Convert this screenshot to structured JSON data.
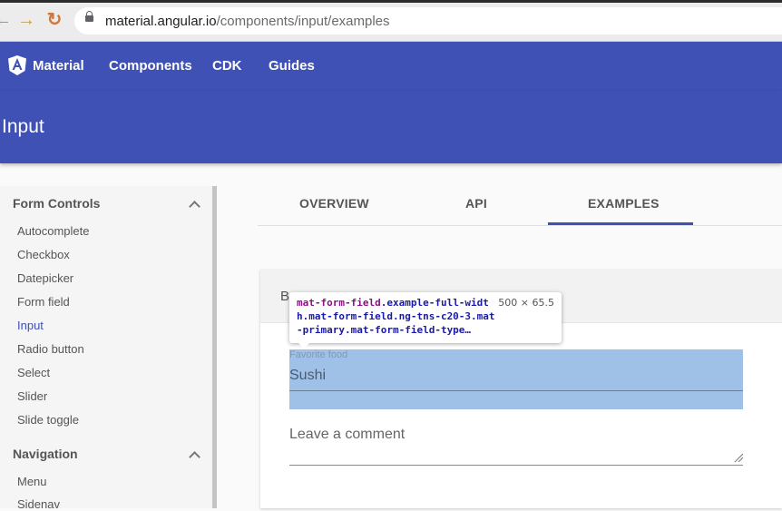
{
  "browser": {
    "url_host": "material.angular.io",
    "url_path": "/components/input/examples",
    "back_glyph": "←",
    "forward_glyph": "→",
    "reload_glyph": "↻"
  },
  "toolbar": {
    "brand": "Material",
    "items": [
      "Components",
      "CDK",
      "Guides"
    ],
    "color": "#3f51b5"
  },
  "header": {
    "title": "Input"
  },
  "sidebar": {
    "groups": [
      {
        "title": "Form Controls",
        "items": [
          "Autocomplete",
          "Checkbox",
          "Datepicker",
          "Form field",
          "Input",
          "Radio button",
          "Select",
          "Slider",
          "Slide toggle"
        ],
        "active": "Input"
      },
      {
        "title": "Navigation",
        "items": [
          "Menu",
          "Sidenav"
        ]
      }
    ]
  },
  "tabs": {
    "items": [
      "OVERVIEW",
      "API",
      "EXAMPLES"
    ],
    "active": "EXAMPLES"
  },
  "example": {
    "title_visible": "B",
    "field1": {
      "label": "Favorite food",
      "value": "Sushi"
    },
    "field2": {
      "placeholder": "Leave a comment"
    }
  },
  "inspector_tooltip": {
    "selector_tag": "mat-form-field",
    "selector_rest": ".example-full-width.mat-form-field.ng-tns-c20-3.mat-primary.mat-form-field-type…",
    "dimensions": "500 × 65.5"
  }
}
